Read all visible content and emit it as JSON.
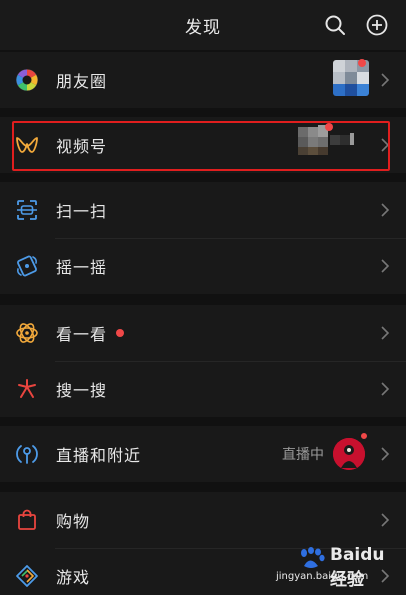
{
  "header": {
    "title": "发现"
  },
  "groups": [
    {
      "items": [
        {
          "label": "朋友圈",
          "icon": "moments-icon"
        }
      ]
    },
    {
      "items": [
        {
          "label": "视频号",
          "icon": "channels-icon"
        }
      ]
    },
    {
      "items": [
        {
          "label": "扫一扫",
          "icon": "scan-icon"
        },
        {
          "label": "摇一摇",
          "icon": "shake-icon"
        }
      ]
    },
    {
      "items": [
        {
          "label": "看一看",
          "icon": "top-stories-icon"
        },
        {
          "label": "搜一搜",
          "icon": "search-icon"
        }
      ]
    },
    {
      "items": [
        {
          "label": "直播和附近",
          "icon": "live-nearby-icon",
          "status": "直播中"
        }
      ]
    },
    {
      "items": [
        {
          "label": "购物",
          "icon": "shopping-bag-icon"
        },
        {
          "label": "游戏",
          "icon": "games-icon"
        }
      ]
    }
  ],
  "watermark": {
    "brand": "Baidu 经验",
    "url": "jingyan.baidu.com"
  },
  "colors": {
    "background": "#111111",
    "row_background": "#191919",
    "badge_red": "#f04848",
    "highlight_border": "#e01e1e"
  }
}
